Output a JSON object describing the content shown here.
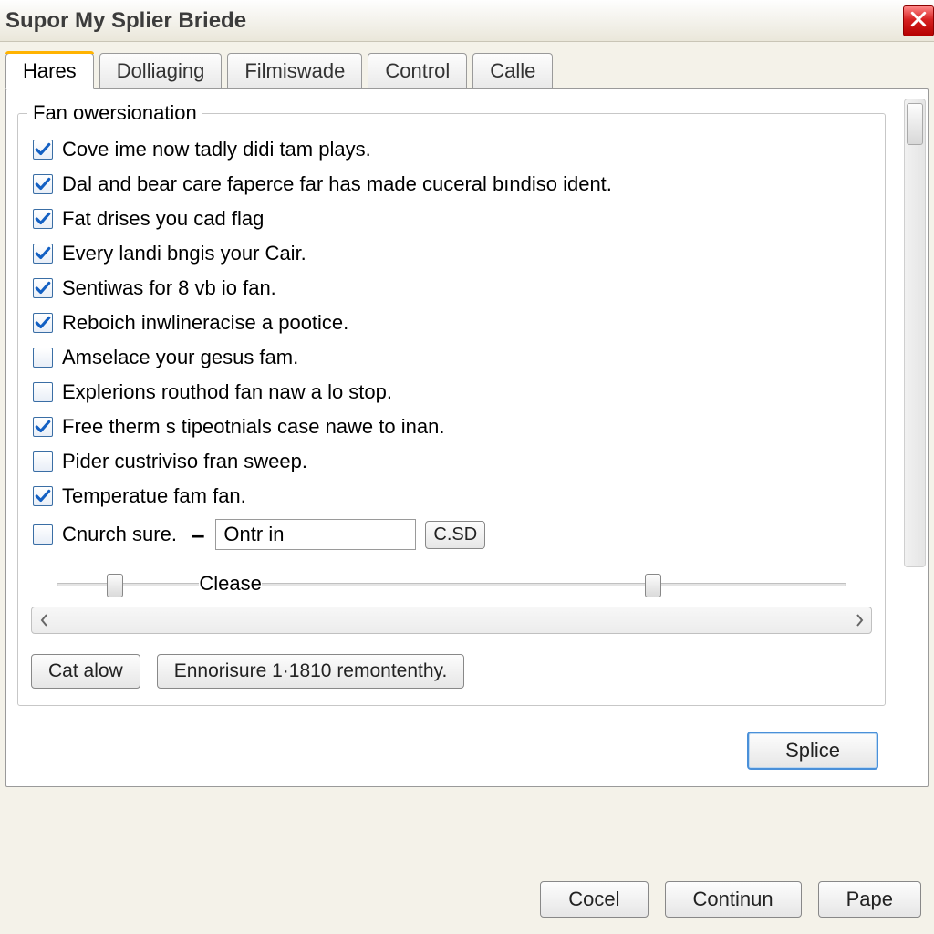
{
  "window": {
    "title": "Supor My Splier Briede"
  },
  "tabs": [
    {
      "label": "Hares",
      "active": true
    },
    {
      "label": "Dolliaging",
      "active": false
    },
    {
      "label": "Filmiswade",
      "active": false
    },
    {
      "label": "Control",
      "active": false
    },
    {
      "label": "Calle",
      "active": false
    }
  ],
  "group": {
    "legend": "Fan owersionation"
  },
  "options": [
    {
      "label": "Cove ime now tadly didi tam plays.",
      "checked": true
    },
    {
      "label": "Dal and bear care faperce far has made cuceral bındiso ident.",
      "checked": true
    },
    {
      "label": "Fat drises you cad flag",
      "checked": true
    },
    {
      "label": "Every landi bngis your Cair.",
      "checked": true
    },
    {
      "label": "Sentiwas for 8 vb io fan.",
      "checked": true
    },
    {
      "label": "Reboich inwlineracise a pootice.",
      "checked": true
    },
    {
      "label": "Amselace your gesus fam.",
      "checked": false
    },
    {
      "label": "Explerions routhod fan naw a lo stop.",
      "checked": false
    },
    {
      "label": "Free therm s tipeotnials case nawe to inan.",
      "checked": true
    },
    {
      "label": "Pider custriviso fran sweep.",
      "checked": false
    },
    {
      "label": "Temperatue fam fan.",
      "checked": true
    }
  ],
  "cnurch": {
    "label": "Cnurch sure.",
    "checked": false,
    "value": "Ontr in",
    "button": "C.SD"
  },
  "slider": {
    "label": "Clease",
    "thumb1_pct": 9,
    "thumb2_pct": 73
  },
  "inner_buttons": {
    "left": "Cat alow",
    "right": "Ennorisure 1·1810 remontenthy."
  },
  "primary": {
    "label": "Splice"
  },
  "dialog_buttons": {
    "ok": "Cocel",
    "continue": "Continun",
    "pape": "Pape"
  },
  "colors": {
    "accent": "#4a90d9",
    "check": "#1360c3",
    "tab_highlight": "#ffb300"
  }
}
